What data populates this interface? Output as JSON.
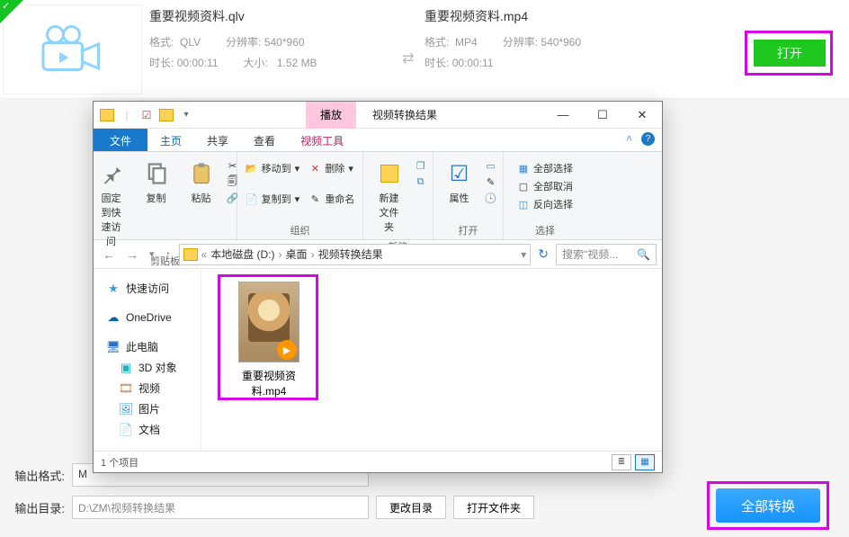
{
  "row": {
    "src": {
      "name": "重要视频资料.qlv",
      "fmt_lbl": "格式:",
      "fmt": "QLV",
      "res_lbl": "分辨率:",
      "res": "540*960",
      "dur_lbl": "时长:",
      "dur": "00:00:11",
      "size_lbl": "大小:",
      "size": "1.52 MB"
    },
    "dst": {
      "name": "重要视频资料.mp4",
      "fmt_lbl": "格式:",
      "fmt": "MP4",
      "res_lbl": "分辨率:",
      "res": "540*960",
      "dur_lbl": "时长:",
      "dur": "00:00:11"
    },
    "open": "打开"
  },
  "bottom": {
    "fmt_lbl": "输出格式:",
    "fmt_val": "M",
    "dir_lbl": "输出目录:",
    "dir_val": "D:\\ZM\\视频转换结果",
    "change": "更改目录",
    "openf": "打开文件夹",
    "convert": "全部转换"
  },
  "explorer": {
    "play_tab": "播放",
    "window_title": "视频转换结果",
    "ribbon": {
      "file": "文件",
      "tabs": [
        "主页",
        "共享",
        "查看",
        "视频工具"
      ],
      "groups": {
        "clipboard": "剪贴板",
        "pin": "固定到快\n速访问",
        "copy": "复制",
        "paste": "粘贴",
        "moveto": "移动到",
        "copyto": "复制到",
        "delete": "删除",
        "rename": "重命名",
        "org": "组织",
        "new": "新建",
        "newfolder": "新建\n文件夹",
        "open": "打开",
        "props": "属性",
        "select": "选择",
        "selectall": "全部选择",
        "selectnone": "全部取消",
        "invert": "反向选择"
      }
    },
    "crumbs": [
      "本地磁盘 (D:)",
      "桌面",
      "视频转换结果"
    ],
    "search_ph": "搜索\"视频...",
    "sidebar": {
      "quick": "快速访问",
      "onedrive": "OneDrive",
      "thispc": "此电脑",
      "sub": [
        "3D 对象",
        "视频",
        "图片",
        "文档"
      ]
    },
    "file1": "重要视频资料.mp4",
    "status": "1 个项目"
  }
}
